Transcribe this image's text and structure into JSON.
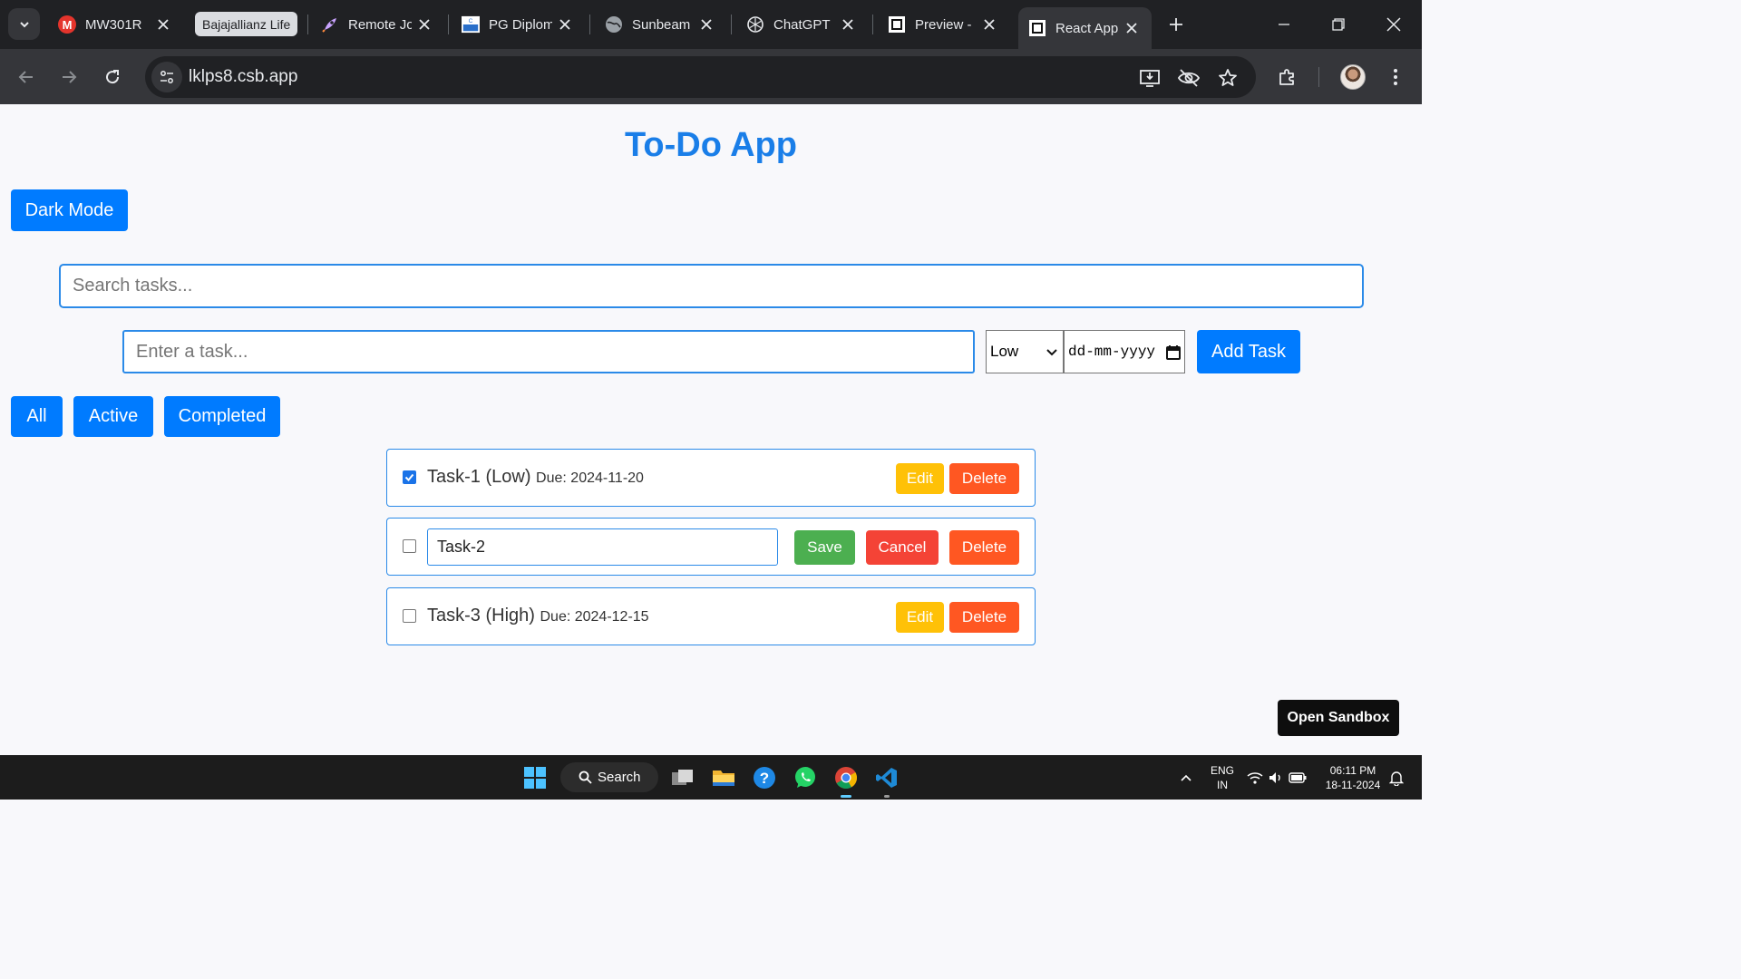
{
  "browser": {
    "tabs": [
      {
        "title": "MW301R",
        "icon": "mercusys-icon"
      },
      {
        "title": "Remote Jo",
        "icon": "rocket-icon"
      },
      {
        "title": "PG Diplom",
        "icon": "cdac-icon"
      },
      {
        "title": "Sunbeam",
        "icon": "globe-icon"
      },
      {
        "title": "ChatGPT",
        "icon": "chatgpt-icon"
      },
      {
        "title": "Preview -",
        "icon": "square-icon"
      },
      {
        "title": "React App",
        "icon": "square-icon",
        "active": true
      }
    ],
    "tab_group_label": "Bajajallianz Life",
    "url": "lklps8.csb.app"
  },
  "app": {
    "title": "To-Do App",
    "dark_mode_label": "Dark Mode",
    "search_placeholder": "Search tasks...",
    "task_placeholder": "Enter a task...",
    "priority_selected": "Low",
    "date_placeholder": "dd-mm-yyyy",
    "add_label": "Add Task",
    "filters": [
      "All",
      "Active",
      "Completed"
    ],
    "tasks": [
      {
        "name": "Task-1 (Low)",
        "due": "Due: 2024-11-20",
        "completed": true
      },
      {
        "edit_value": "Task-2",
        "editing": true,
        "completed": false
      },
      {
        "name": "Task-3 (High)",
        "due": "Due: 2024-12-15",
        "completed": false
      }
    ],
    "edit_label": "Edit",
    "delete_label": "Delete",
    "save_label": "Save",
    "cancel_label": "Cancel",
    "sandbox_label": "Open Sandbox"
  },
  "taskbar": {
    "search_label": "Search",
    "lang_1": "ENG",
    "lang_2": "IN",
    "time": "06:11 PM",
    "date": "18-11-2024"
  },
  "colors": {
    "accent": "#007bff",
    "title": "#1a7ee8",
    "edit": "#ffc107",
    "delete": "#ff5722",
    "save": "#4caf50",
    "cancel": "#f44336"
  }
}
